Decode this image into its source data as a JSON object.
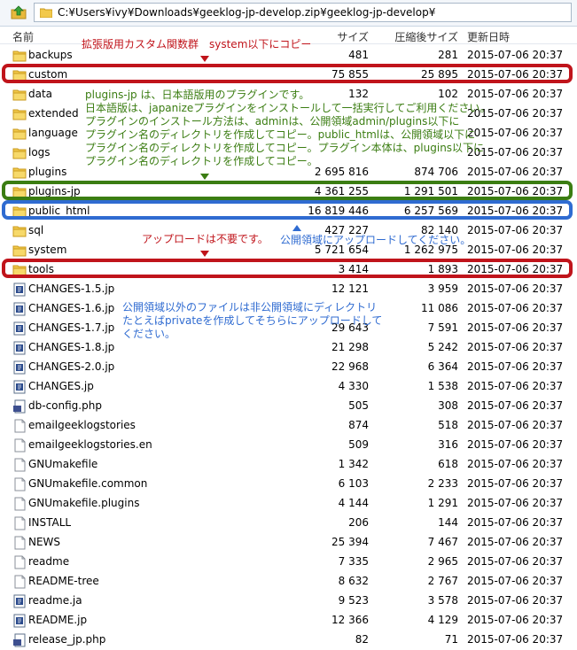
{
  "address": {
    "path": "C:¥Users¥ivy¥Downloads¥geeklog-jp-develop.zip¥geeklog-jp-develop¥"
  },
  "header": {
    "name": "名前",
    "size": "サイズ",
    "csize": "圧縮後サイズ",
    "date": "更新日時"
  },
  "files": [
    {
      "name": "backups",
      "type": "folder",
      "size": "481",
      "csize": "281",
      "date": "2015-07-06 20:37"
    },
    {
      "name": "custom",
      "type": "folder",
      "size": "75 855",
      "csize": "25 895",
      "date": "2015-07-06 20:37"
    },
    {
      "name": "data",
      "type": "folder",
      "size": "132",
      "csize": "102",
      "date": "2015-07-06 20:37"
    },
    {
      "name": "extended",
      "type": "folder",
      "size": "",
      "csize": "",
      "date": "2015-07-06 20:37"
    },
    {
      "name": "language",
      "type": "folder",
      "size": "",
      "csize": "",
      "date": "2015-07-06 20:37"
    },
    {
      "name": "logs",
      "type": "folder",
      "size": "",
      "csize": "",
      "date": "2015-07-06 20:37"
    },
    {
      "name": "plugins",
      "type": "folder",
      "size": "2 695 816",
      "csize": "874 706",
      "date": "2015-07-06 20:37"
    },
    {
      "name": "plugins-jp",
      "type": "folder",
      "size": "4 361 255",
      "csize": "1 291 501",
      "date": "2015-07-06 20:37"
    },
    {
      "name": "public_html",
      "type": "folder",
      "size": "16 819 446",
      "csize": "6 257 569",
      "date": "2015-07-06 20:37"
    },
    {
      "name": "sql",
      "type": "folder",
      "size": "427 227",
      "csize": "82 140",
      "date": "2015-07-06 20:37"
    },
    {
      "name": "system",
      "type": "folder",
      "size": "5 721 654",
      "csize": "1 262 975",
      "date": "2015-07-06 20:37"
    },
    {
      "name": "tools",
      "type": "folder",
      "size": "3 414",
      "csize": "1 893",
      "date": "2015-07-06 20:37"
    },
    {
      "name": "CHANGES-1.5.jp",
      "type": "doc",
      "size": "12 121",
      "csize": "3 959",
      "date": "2015-07-06 20:37"
    },
    {
      "name": "CHANGES-1.6.jp",
      "type": "doc",
      "size": "",
      "csize": "11 086",
      "date": "2015-07-06 20:37"
    },
    {
      "name": "CHANGES-1.7.jp",
      "type": "doc",
      "size": "29 643",
      "csize": "7 591",
      "date": "2015-07-06 20:37"
    },
    {
      "name": "CHANGES-1.8.jp",
      "type": "doc",
      "size": "21 298",
      "csize": "5 242",
      "date": "2015-07-06 20:37"
    },
    {
      "name": "CHANGES-2.0.jp",
      "type": "doc",
      "size": "22 968",
      "csize": "6 364",
      "date": "2015-07-06 20:37"
    },
    {
      "name": "CHANGES.jp",
      "type": "doc",
      "size": "4 330",
      "csize": "1 538",
      "date": "2015-07-06 20:37"
    },
    {
      "name": "db-config.php",
      "type": "php",
      "size": "505",
      "csize": "308",
      "date": "2015-07-06 20:37"
    },
    {
      "name": "emailgeeklogstories",
      "type": "blank",
      "size": "874",
      "csize": "518",
      "date": "2015-07-06 20:37"
    },
    {
      "name": "emailgeeklogstories.en",
      "type": "blank",
      "size": "509",
      "csize": "316",
      "date": "2015-07-06 20:37"
    },
    {
      "name": "GNUmakefile",
      "type": "blank",
      "size": "1 342",
      "csize": "618",
      "date": "2015-07-06 20:37"
    },
    {
      "name": "GNUmakefile.common",
      "type": "blank",
      "size": "6 103",
      "csize": "2 233",
      "date": "2015-07-06 20:37"
    },
    {
      "name": "GNUmakefile.plugins",
      "type": "blank",
      "size": "4 144",
      "csize": "1 291",
      "date": "2015-07-06 20:37"
    },
    {
      "name": "INSTALL",
      "type": "blank",
      "size": "206",
      "csize": "144",
      "date": "2015-07-06 20:37"
    },
    {
      "name": "NEWS",
      "type": "blank",
      "size": "25 394",
      "csize": "7 467",
      "date": "2015-07-06 20:37"
    },
    {
      "name": "readme",
      "type": "blank",
      "size": "7 335",
      "csize": "2 965",
      "date": "2015-07-06 20:37"
    },
    {
      "name": "README-tree",
      "type": "blank",
      "size": "8 632",
      "csize": "2 767",
      "date": "2015-07-06 20:37"
    },
    {
      "name": "readme.ja",
      "type": "doc",
      "size": "9 523",
      "csize": "3 578",
      "date": "2015-07-06 20:37"
    },
    {
      "name": "README.jp",
      "type": "doc",
      "size": "12 366",
      "csize": "4 129",
      "date": "2015-07-06 20:37"
    },
    {
      "name": "release_jp.php",
      "type": "php",
      "size": "82",
      "csize": "71",
      "date": "2015-07-06 20:37"
    }
  ],
  "annotations": {
    "custom_note": "拡張版用カスタム関数群　system以下にコピー",
    "plugins_jp_note": [
      "plugins-jp は、日本語版用のプラグインです。",
      "日本語版は、japanizeプラグインをインストールして一括実行してご利用ください。",
      "プラグインのインストール方法は、adminは、公開領域admin/plugins以下に",
      "プラグイン名のディレクトリを作成してコピー。public_htmlは、公開領域以下に",
      "プラグイン名のディレクトリを作成してコピー。プラグイン本体は、plugins以下に",
      "プラグイン名のディレクトリを作成してコピー。"
    ],
    "tools_note": "アップロードは不要です。",
    "public_note": "公開領域にアップロードしてください。",
    "private_note": [
      "公開領域以外のファイルは非公開領域にディレクトリ",
      "たとえばprivateを作成してそちらにアップロードして",
      "ください。"
    ]
  },
  "colors": {
    "red": "#c0141b",
    "green": "#3b7d12",
    "blue": "#2f6bd1"
  }
}
